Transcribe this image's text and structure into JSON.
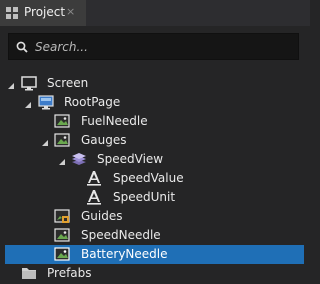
{
  "panel": {
    "tab_label": "Project",
    "tab_close": "×",
    "search_placeholder": "Search..."
  },
  "tree": [
    {
      "label": "Screen",
      "icon": "monitor-icon",
      "expanded": true
    },
    {
      "label": "RootPage",
      "icon": "page-icon",
      "expanded": true
    },
    {
      "label": "FuelNeedle",
      "icon": "image-icon"
    },
    {
      "label": "Gauges",
      "icon": "image-icon",
      "expanded": true
    },
    {
      "label": "SpeedView",
      "icon": "layers-icon",
      "expanded": true
    },
    {
      "label": "SpeedValue",
      "icon": "text-icon"
    },
    {
      "label": "SpeedUnit",
      "icon": "text-icon"
    },
    {
      "label": "Guides",
      "icon": "image-lock-icon"
    },
    {
      "label": "SpeedNeedle",
      "icon": "image-icon"
    },
    {
      "label": "BatteryNeedle",
      "icon": "image-icon",
      "selected": true
    },
    {
      "label": "Prefabs",
      "icon": "folder-icon"
    }
  ],
  "colors": {
    "background": "#252526",
    "selection": "#1f6fb6",
    "image_icon_green": "#6aa84f"
  }
}
